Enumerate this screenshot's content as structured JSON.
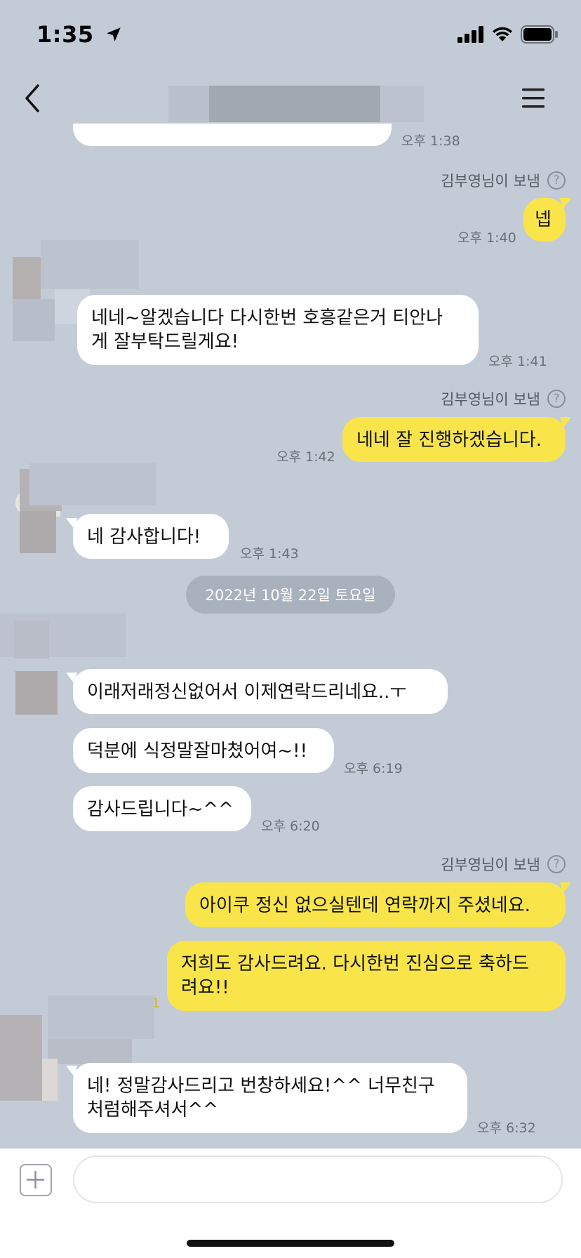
{
  "status": {
    "time": "1:35"
  },
  "messages": {
    "m0_time": "오후 1:38",
    "sent_by_1": "김부영님이 보냄",
    "m1_text": "넵",
    "m1_time": "오후 1:40",
    "m2_text_line1": "네네~알겠습니다 다시한번 호흥같은거 티안나",
    "m2_text_line2": "게 잘부탁드릴게요!",
    "m2_time": "오후 1:41",
    "sent_by_2": "김부영님이 보냄",
    "m3_text": "네네 잘 진행하겠습니다.",
    "m3_time": "오후 1:42",
    "m4_text": "네 감사합니다!",
    "m4_time": "오후 1:43",
    "date_divider": "2022년 10월 22일 토요일",
    "m5_text": "이래저래정신없어서 이제연락드리네요..ㅜ",
    "m6_text": "덕분에 식정말잘마쳤어여~!!",
    "m6_time": "오후 6:19",
    "m7_text": "감사드립니다~^^",
    "m7_time": "오후 6:20",
    "sent_by_3": "김부영님이 보냄",
    "m8_text": "아이쿠 정신 없으실텐데 연락까지 주셨네요.",
    "m9_text_line1": "저희도 감사드려요. 다시한번 진심으로 축하드",
    "m9_text_line2": "려요!!",
    "m9_unread": "1",
    "m10_text_line1": "네! 정말감사드리고 번창하세요!^^ 너무친구",
    "m10_text_line2": "처럼해주셔서^^",
    "m10_time": "오후 6:32"
  },
  "colors": {
    "background": "#c3cbd7",
    "outgoing": "#f9e54a",
    "incoming": "#ffffff"
  },
  "icons": [
    "location-arrow-icon",
    "signal-icon",
    "wifi-icon",
    "battery-icon",
    "back-chevron-icon",
    "hamburger-menu-icon",
    "plus-icon",
    "help-icon"
  ]
}
